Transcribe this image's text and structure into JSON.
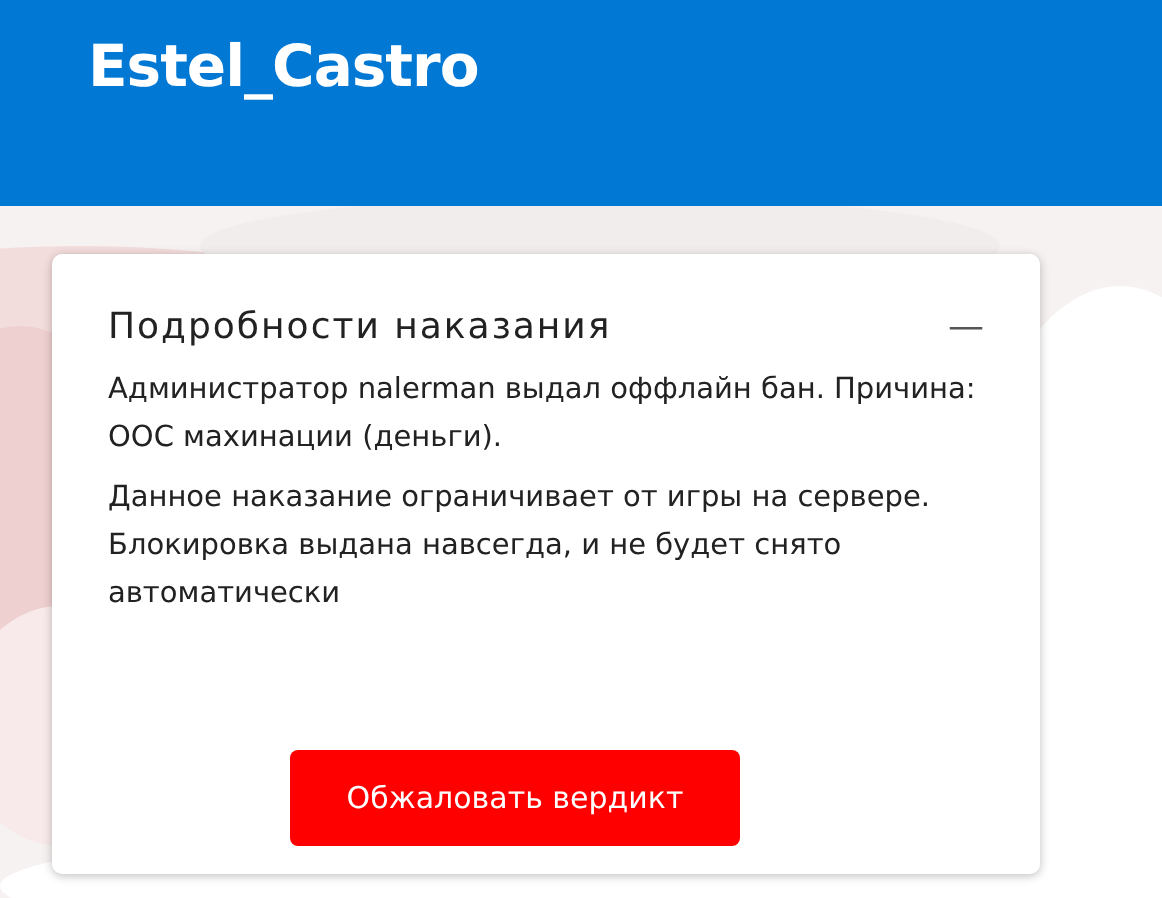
{
  "header": {
    "title": "Estel_Castro"
  },
  "panel": {
    "title": "Подробности наказания",
    "collapse_toggle": "—",
    "paragraphs": [
      "Администратор nalerman выдал оффлайн бан. Причина: ООС махинации (деньги).",
      "Данное наказание ограничивает от игры на сервере. Блокировка выдана навсегда, и не будет снято автоматически"
    ],
    "button": "Обжаловать вердикт"
  }
}
